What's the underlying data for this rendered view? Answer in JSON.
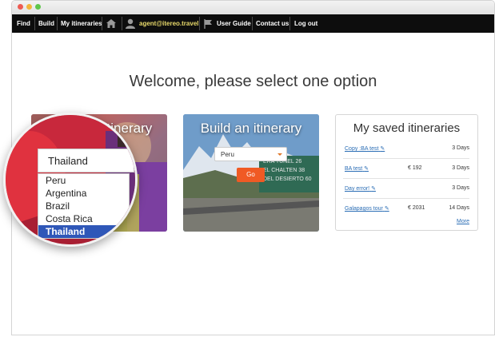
{
  "navbar": {
    "find": "Find",
    "build": "Build",
    "my_itineraries": "My itineraries",
    "user_email": "agent@itereo.travel",
    "user_guide": "User Guide",
    "contact_us": "Contact us",
    "log_out": "Log out"
  },
  "welcome": "Welcome, please select one option",
  "find_card": {
    "title": "itinerary"
  },
  "build_card": {
    "title": "Build an itinerary",
    "select_value": "Peru",
    "go_label": "Go",
    "sign_lines": [
      "ERA TUNEL 26",
      "EL CHALTEN 38",
      "DEL DESIERTO 60"
    ]
  },
  "saved": {
    "title": "My saved itineraries",
    "rows": [
      {
        "name": "Copy :BA test",
        "price": "",
        "days": "3 Days"
      },
      {
        "name": "BA test",
        "price": "€ 192",
        "days": "3 Days"
      },
      {
        "name": "Day error!",
        "price": "",
        "days": "3 Days"
      },
      {
        "name": "Galapagos tour",
        "price": "€ 2031",
        "days": "14 Days"
      }
    ],
    "more": "More"
  },
  "magnifier": {
    "selected": "Thailand",
    "options": [
      "Peru",
      "Argentina",
      "Brazil",
      "Costa Rica",
      "Thailand"
    ],
    "selected_index": 4
  },
  "colors": {
    "navbar": "#0d0d0d",
    "go_button": "#f05a24",
    "link": "#2a6db5",
    "selected_option": "#2f57b8"
  }
}
